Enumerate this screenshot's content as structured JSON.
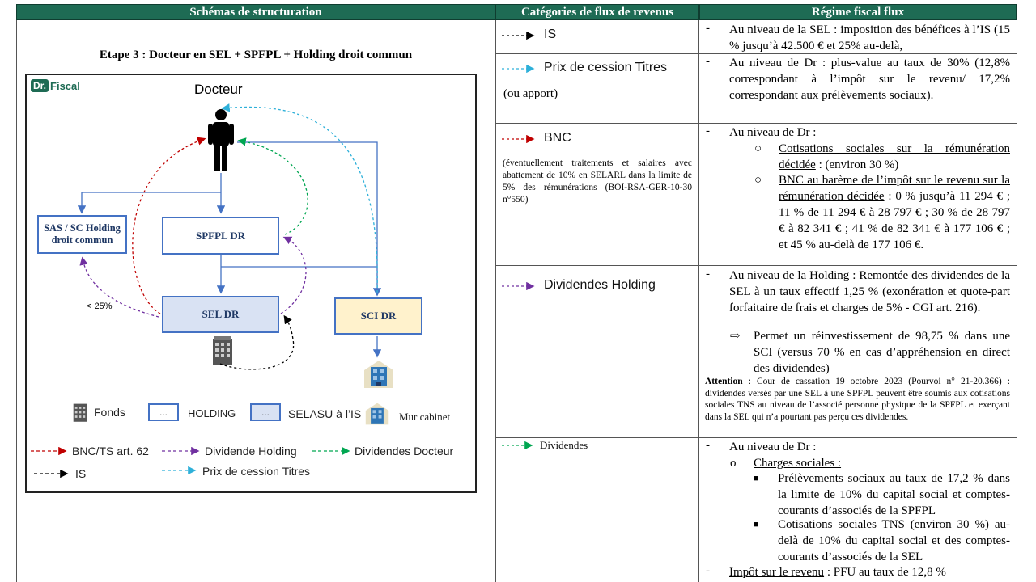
{
  "headers": {
    "col1": "Schémas de structuration",
    "col2": "Catégories de flux de revenus",
    "col3": "Régime fiscal flux"
  },
  "diagram": {
    "title": "Etape 3 : Docteur en SEL + SPFPL + Holding droit commun",
    "logo_dr": "Dr.",
    "logo_fiscal": "Fiscal",
    "docteur": "Docteur",
    "holding_box": "SAS / SC Holding droit commun",
    "spfpl_box": "SPFPL DR",
    "sel_box": "SEL DR",
    "sci_box": "SCI DR",
    "pct_label": "< 25%",
    "legend": {
      "fonds": "Fonds",
      "dots": "...",
      "holding": "HOLDING",
      "selasu": "SELASU à l’IS",
      "mur": "Mur cabinet",
      "bnc": "BNC/TS art. 62",
      "div_holding": "Dividende Holding",
      "div_docteur": "Dividendes Docteur",
      "is": "IS",
      "prix": "Prix de cession Titres"
    },
    "colors": {
      "red": "#c00000",
      "purple": "#7030a0",
      "green": "#00a651",
      "cyan": "#2eb0d9",
      "black": "#000000",
      "blue_line": "#4472c4",
      "header_green": "#1e6b54"
    }
  },
  "categories": {
    "is": "IS",
    "prix": "Prix de cession Titres",
    "apport": "(ou apport)",
    "bnc": "BNC",
    "bnc_note": "(éventuellement traitements et salaires avec abattement de 10% en SELARL dans la limite de 5% des rémunérations (BOI-RSA-GER-10-30 n°550)",
    "div_holding": "Dividendes Holding",
    "dividendes": "Dividendes"
  },
  "regime": {
    "r1_dash": "-",
    "r1": "Au niveau de la SEL : imposition des bénéfices à l’IS (15 % jusqu’à 42.500 € et 25% au-delà,",
    "r2": "Au niveau de Dr : plus-value au taux de 30% (12,8% correspondant à l’impôt sur le revenu/ 17,2% correspondant aux prélèvements sociaux).",
    "r3_head": "Au niveau de Dr :",
    "r3_a_u": "Cotisations sociales sur la rémunération décidée",
    "r3_a": " : (environ 30 %)",
    "r3_b_u": "BNC au barème de l’impôt sur le revenu sur la rémunération décidée",
    "r3_b": " : 0 % jusqu’à 11 294 € ; 11 % de 11 294 € à 28 797 € ; 30 % de 28 797 € à 82 341 € ; 41 % de 82 341 € à 177 106 € ; et 45 % au-delà de 177 106 €.",
    "r4": "Au niveau de la Holding : Remontée des dividendes de la SEL à un taux effectif 1,25 % (exonération et quote-part forfaitaire de frais et charges de 5% - CGI art. 216).",
    "r4_arrow": "Permet un réinvestissement de 98,75 % dans une SCI (versus 70 % en cas d’appréhension en direct des dividendes)",
    "attention_label": "Attention",
    "attention": " : Cour de cassation 19 octobre 2023 (Pourvoi n° 21-20.366) : dividendes versés par une SEL à une SPFPL peuvent être soumis aux cotisations sociales TNS au niveau de l’associé personne physique de la SPFPL et exerçant dans la SEL qui n’a pourtant pas perçu ces dividendes.",
    "r5_head": "Au niveau de Dr :",
    "r5_a_u": "Charges sociales :",
    "r5_b": "Prélèvements sociaux au taux de 17,2 % dans la limite de 10% du capital social et comptes-courants d’associés de la SPFPL",
    "r5_c_u": "Cotisations sociales TNS",
    "r5_c": " (environ 30 %) au-delà de 10% du capital social et des comptes-courants d’associés de la SEL",
    "r5_d_u": "Impôt sur le revenu",
    "r5_d": " : PFU au taux de 12,8 %"
  }
}
